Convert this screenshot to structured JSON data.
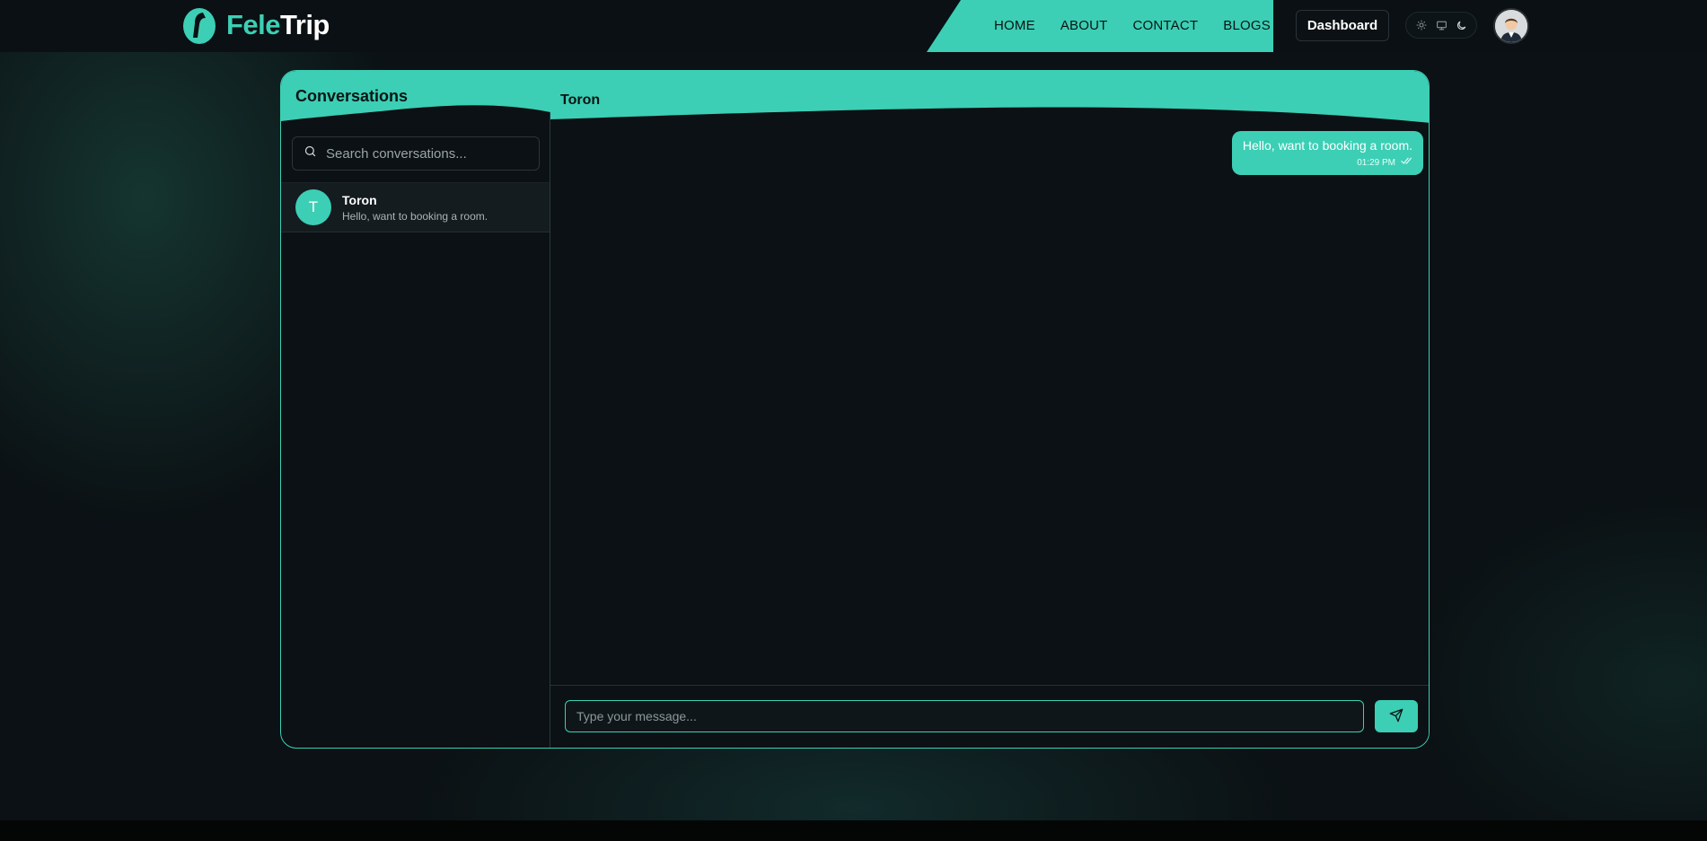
{
  "brand": {
    "name_part1": "Fele",
    "name_part2": "Trip",
    "accent": "#3ccfb5"
  },
  "nav": {
    "items": [
      {
        "label": "HOME"
      },
      {
        "label": "ABOUT"
      },
      {
        "label": "CONTACT"
      },
      {
        "label": "BLOGS"
      }
    ]
  },
  "header": {
    "dashboard_label": "Dashboard",
    "theme_icons": [
      "sun-icon",
      "monitor-icon",
      "moon-icon"
    ]
  },
  "sidebar": {
    "title": "Conversations",
    "search_placeholder": "Search conversations...",
    "conversations": [
      {
        "initial": "T",
        "name": "Toron",
        "preview": "Hello, want to booking a room."
      }
    ]
  },
  "chat": {
    "title": "Toron",
    "messages": [
      {
        "text": "Hello, want to booking a room.",
        "time": "01:29 PM",
        "status_icon": "double-check-icon"
      }
    ],
    "input_placeholder": "Type your message...",
    "send_icon": "send-icon"
  }
}
